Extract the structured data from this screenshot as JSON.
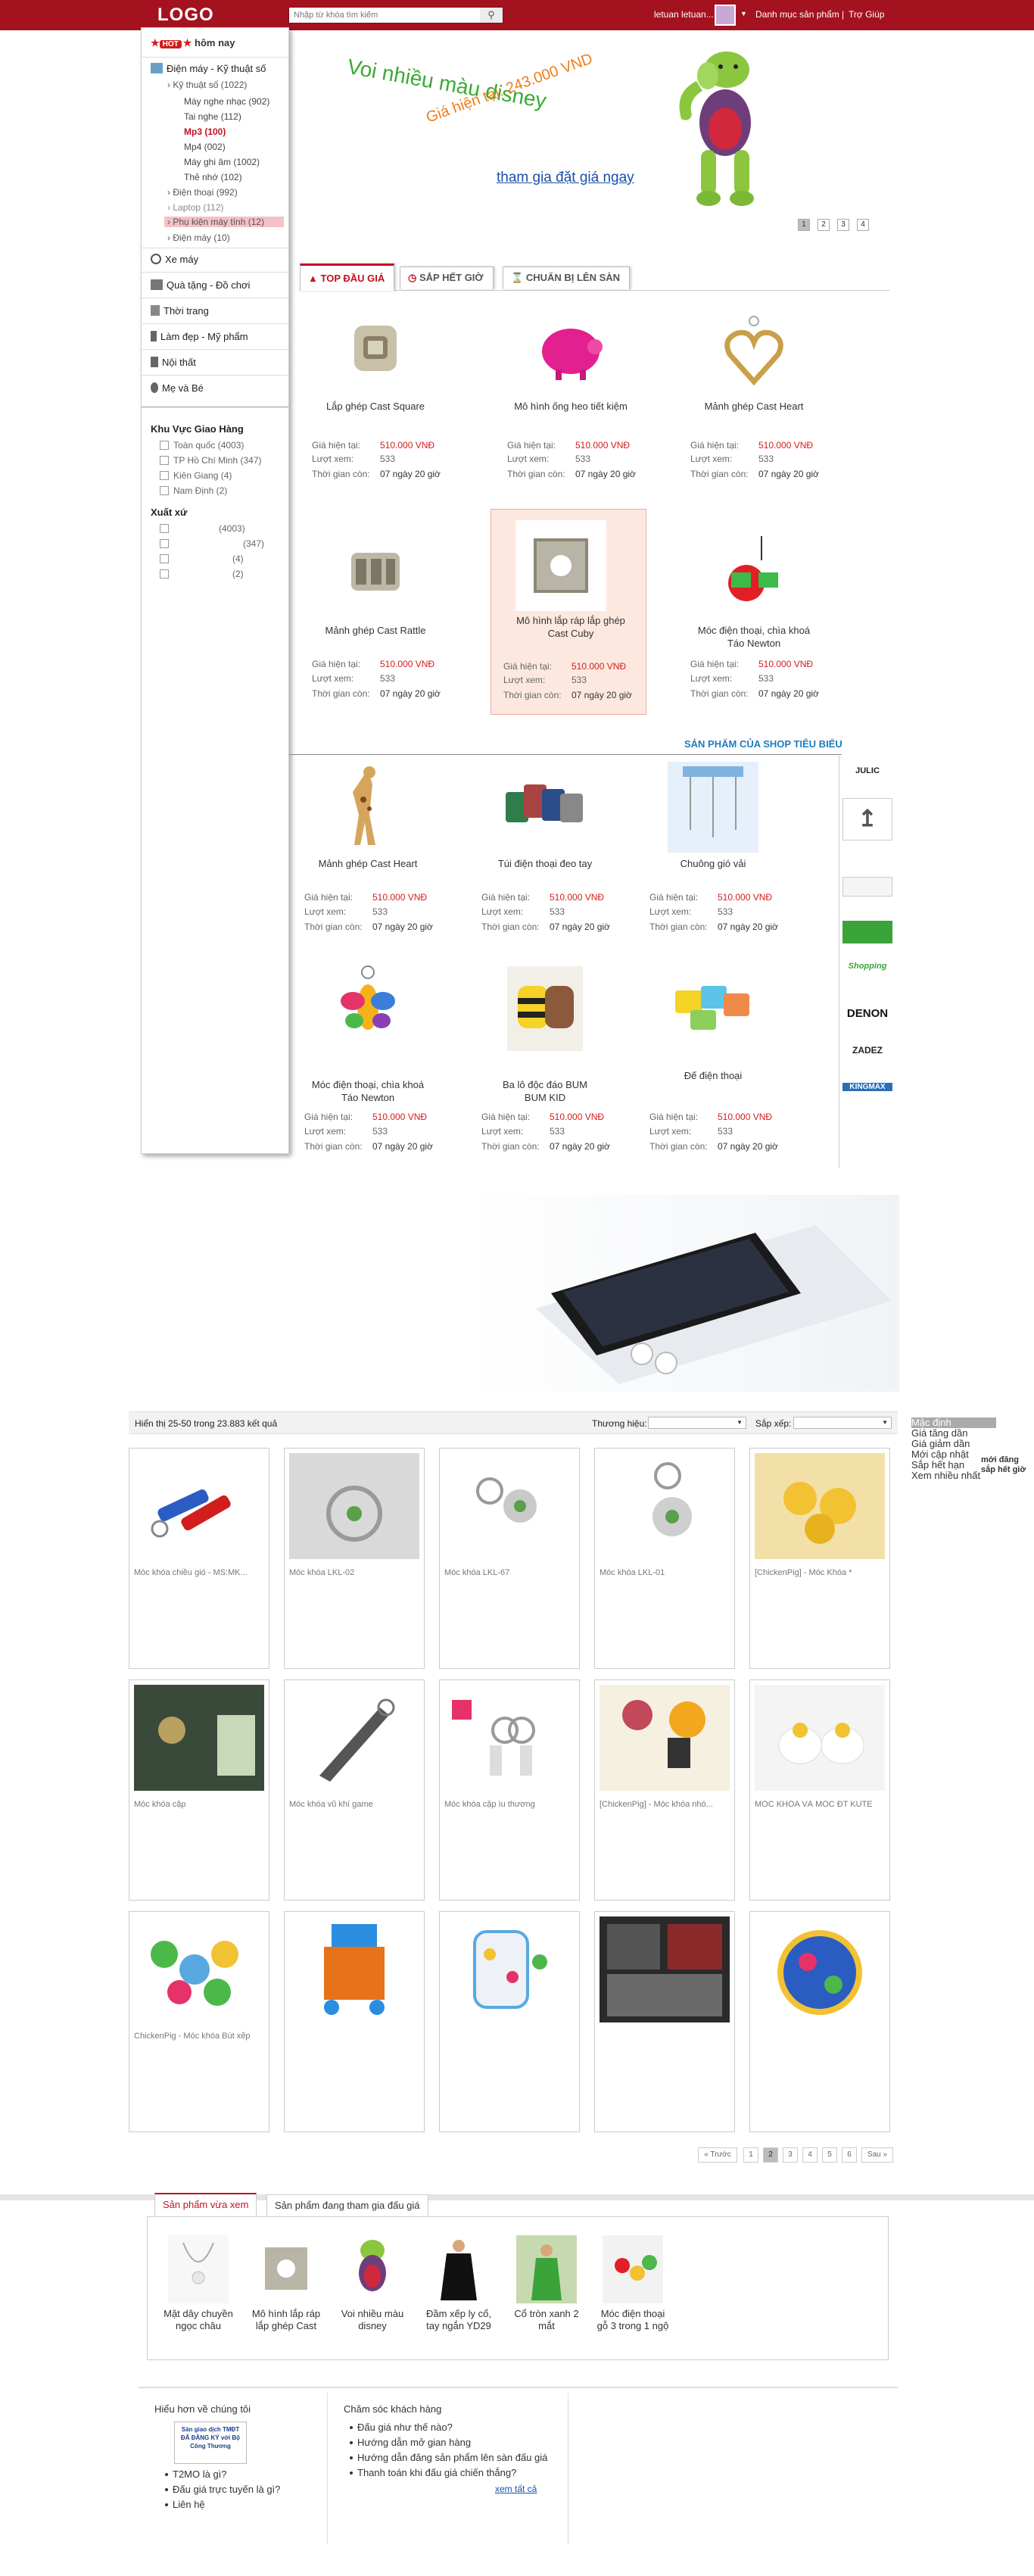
{
  "header": {
    "logo": "LOGO",
    "search_placeholder": "Nhập từ khóa tìm kiếm",
    "user": "letuan letuan...",
    "nav": [
      "Danh mục sản phẩm",
      "Trợ Giúp"
    ]
  },
  "sidebar": {
    "hot_badge": "HOT",
    "hot_label": "hôm nay",
    "categories": [
      {
        "label": "Điện máy - Kỹ thuật số",
        "icon": "tv-icon"
      },
      {
        "label": "Xe máy",
        "icon": "wheel-icon"
      },
      {
        "label": "Quà tặng - Đồ chơi",
        "icon": "gift-icon"
      },
      {
        "label": "Thời trang",
        "icon": "shirt-icon"
      },
      {
        "label": "Làm đẹp - Mỹ phẩm",
        "icon": "bottle-icon"
      },
      {
        "label": "Nội thất",
        "icon": "chair-icon"
      },
      {
        "label": "Mẹ và Bé",
        "icon": "baby-icon"
      }
    ],
    "ktso": "Kỹ thuật số (1022)",
    "ktso_items": [
      "Máy nghe nhạc (902)",
      "Tai nghe (112)",
      "Mp3 (100)",
      "Mp4 (002)",
      "Máy ghi âm (1002)",
      "Thẻ nhớ (102)"
    ],
    "more_items": [
      "Điện thoại (992)",
      "Laptop (112)",
      "Phụ kiện máy tính (12)",
      "Điện máy (10)"
    ],
    "delivery_title": "Khu Vực Giao Hàng",
    "delivery": [
      "Toàn quốc (4003)",
      "TP Hồ Chí Minh (347)",
      "Kiên Giang (4)",
      "Nam Định (2)"
    ],
    "origin_title": "Xuất xứ",
    "origin": [
      "(4003)",
      "(347)",
      "(4)",
      "(2)"
    ]
  },
  "banner": {
    "title": "Voi nhiều màu disney",
    "price": "Giá hiện tại: 243.000 VND",
    "cta": "tham gia đặt giá ngay",
    "pages": [
      "1",
      "2",
      "3",
      "4"
    ]
  },
  "tabs": [
    "TOP ĐẦU GIÁ",
    "SẮP HẾT GIỜ",
    "CHUẨN BỊ LÊN SÀN"
  ],
  "labels": {
    "price": "Giá hiện tại:",
    "views": "Lượt xem:",
    "time": "Thời gian còn:"
  },
  "top_products": [
    {
      "name": "Lắp ghép Cast Square",
      "price": "510.000 VNĐ",
      "views": "533",
      "time": "07 ngày 20 giờ"
    },
    {
      "name": "Mô hình ống heo tiết kiệm",
      "price": "510.000 VNĐ",
      "views": "533",
      "time": "07 ngày 20 giờ"
    },
    {
      "name": "Mảnh ghép Cast Heart",
      "price": "510.000 VNĐ",
      "views": "533",
      "time": "07 ngày 20 giờ"
    },
    {
      "name": "Mảnh ghép Cast Rattle",
      "price": "510.000 VNĐ",
      "views": "533",
      "time": "07 ngày 20 giờ"
    },
    {
      "name": "Mô hình lắp ráp lắp ghép Cast Cuby",
      "price": "510.000 VNĐ",
      "views": "533",
      "time": "07 ngày 20 giờ"
    },
    {
      "name": "Móc điện thoại, chìa khoá Táo Newton",
      "price": "510.000 VNĐ",
      "views": "533",
      "time": "07 ngày 20 giờ"
    }
  ],
  "shop_section": "SẢN PHẨM CỦA SHOP TIÊU BIỂU",
  "shop_products": [
    {
      "name": "Mảnh ghép Cast Heart",
      "price": "510.000 VNĐ",
      "views": "533",
      "time": "07 ngày 20 giờ"
    },
    {
      "name": "Túi điện thoại đeo tay",
      "price": "510.000 VNĐ",
      "views": "533",
      "time": "07 ngày 20 giờ"
    },
    {
      "name": "Chuông gió vải",
      "price": "510.000 VNĐ",
      "views": "533",
      "time": "07 ngày 20 giờ"
    },
    {
      "name": "Móc điện thoại, chìa khoá Táo Newton",
      "price": "510.000 VNĐ",
      "views": "533",
      "time": "07 ngày 20 giờ"
    },
    {
      "name": "Ba lô độc đáo BUM BUM KID",
      "price": "510.000 VNĐ",
      "views": "533",
      "time": "07 ngày 20 giờ"
    },
    {
      "name": "Đế điện thoại",
      "price": "510.000 VNĐ",
      "views": "533",
      "time": "07 ngày 20 giờ"
    }
  ],
  "brands": [
    "JULIC",
    "",
    "",
    "",
    "Shopping",
    "DENON",
    "ZADEZ",
    "KINGMAX"
  ],
  "results": {
    "summary": "Hiển thị 25-50 trong 23.883 kết quả",
    "brand_label": "Thương hiệu:",
    "sort_label": "Sắp xếp:",
    "sort_options": [
      "Mặc định",
      "Giá tăng dần",
      "Giá giảm dần",
      "Mới cập nhật",
      "Sắp hết hạn",
      "Xem nhiều nhất"
    ],
    "sort_note": "mới đăng sắp hết giờ"
  },
  "grid": [
    "Móc khóa chiều gió - MS:MK...",
    "Móc khóa LKL-02",
    "Móc khóa LKL-67",
    "Móc khóa LKL-01",
    "[ChickenPig] - Móc Khóa *",
    "Móc khóa cặp",
    "Móc khóa vũ khí game",
    "Móc khóa cặp ìu thương",
    "[ChickenPig] - Móc khóa nhó...",
    "MÓC KHÓA VÀ MÓC ĐT KUTE",
    "ChickenPig - Móc khóa Bút xếp",
    "",
    "",
    "",
    ""
  ],
  "pager": [
    "« Trước",
    "1",
    "2",
    "3",
    "4",
    "5",
    "6",
    "Sau »"
  ],
  "recent_tabs": [
    "Sản phẩm vừa xem",
    "Sản phẩm đang tham gia đấu giá"
  ],
  "recent": [
    "Mặt dây chuyền ngọc châu",
    "Mô hình lắp ráp lắp ghép Cast",
    "Voi nhiều màu disney",
    "Đầm xếp ly cổ, tay ngắn YD29",
    "Cổ tròn xanh 2 mắt",
    "Móc điện thoại gỗ 3 trong 1 ngộ"
  ],
  "footer": {
    "about_title": "Hiểu hơn về chúng tôi",
    "badge": "Sàn giao dịch TMĐT ĐÃ ĐĂNG KÝ với Bộ Công Thương",
    "about_links": [
      "T2MO là gì?",
      "Đấu giá trực tuyến là gì?",
      "Liên hệ"
    ],
    "care_title": "Chăm sóc khách hàng",
    "care_links": [
      "Đấu giá như thế nào?",
      "Hướng dẫn mở gian hàng",
      "Hướng dẫn đăng sản phẩm lên sàn đấu giá",
      "Thanh toán khi đấu giá chiến thắng?"
    ],
    "see_all": "xem tất cả"
  }
}
